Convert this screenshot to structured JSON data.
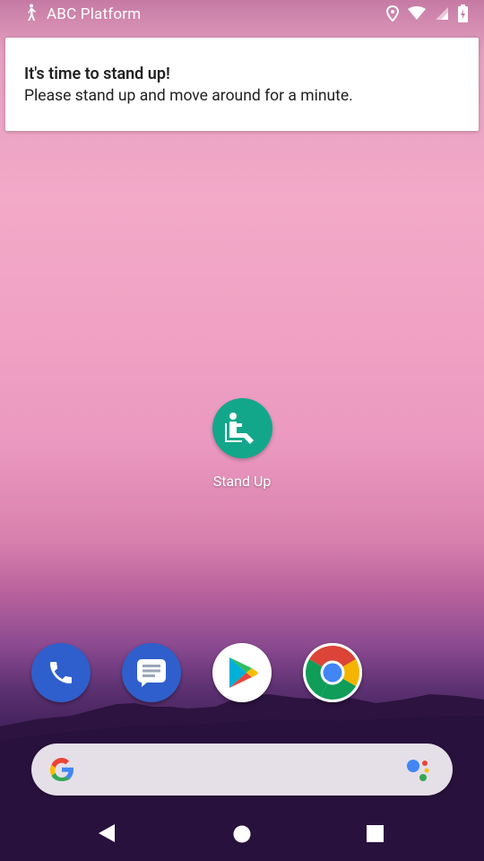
{
  "status_bar": {
    "app_name": "ABC Platform",
    "icons": [
      "walking-person-icon",
      "location-icon",
      "wifi-icon",
      "cell-signal-icon",
      "battery-charging-icon"
    ]
  },
  "notification": {
    "title": "It's time to stand up!",
    "body": "Please stand up and move around for a minute."
  },
  "home": {
    "app_label": "Stand Up",
    "app_icon": "sitting-person-icon",
    "app_color": "#12a78b"
  },
  "dock": {
    "apps": [
      "phone-icon",
      "messages-icon",
      "play-store-icon",
      "chrome-icon"
    ]
  },
  "search": {
    "left_icon": "google-g-icon",
    "right_icon": "assistant-icon"
  },
  "nav": {
    "buttons": [
      "back-icon",
      "home-icon",
      "recents-icon"
    ]
  }
}
